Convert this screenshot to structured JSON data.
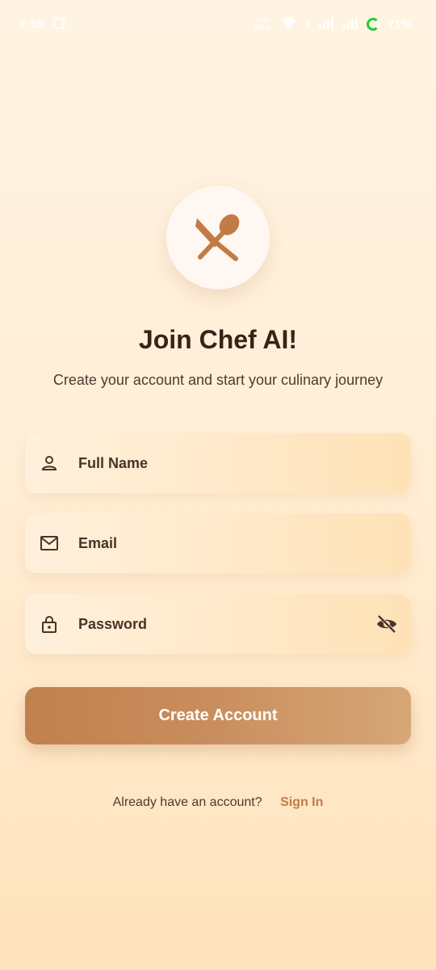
{
  "status_bar": {
    "time": "7:55",
    "speed": "0.00 KB/S",
    "battery": "71%"
  },
  "app": {
    "title": "Join Chef AI!",
    "subtitle": "Create your account and start your culinary journey"
  },
  "form": {
    "full_name_placeholder": "Full Name",
    "email_placeholder": "Email",
    "password_placeholder": "Password",
    "submit_label": "Create Account"
  },
  "footer": {
    "prompt": "Already have an account?",
    "signin_label": "Sign In"
  },
  "colors": {
    "accent": "#C27B47",
    "title": "#3A2218",
    "background": "#FFEED7"
  }
}
